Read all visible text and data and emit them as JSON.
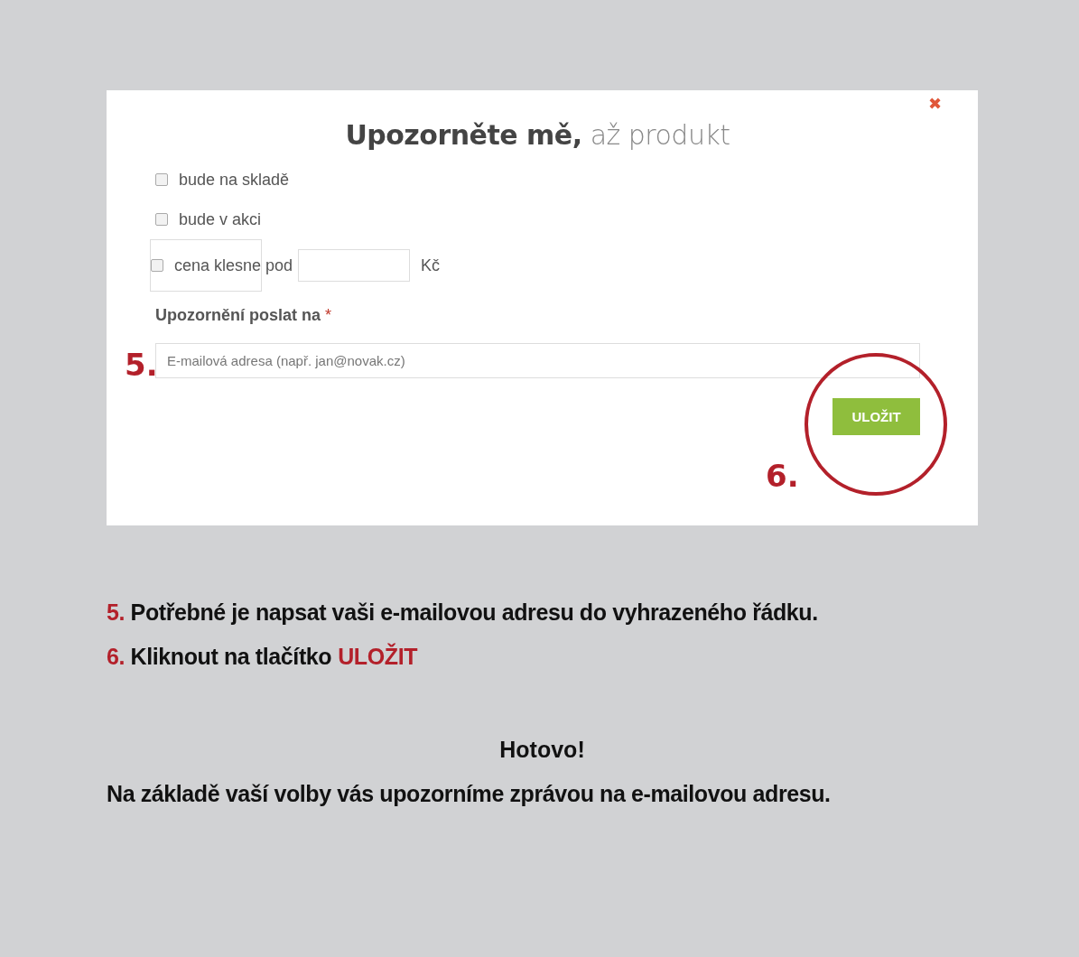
{
  "dialog": {
    "close_glyph": "✖",
    "title_bold": "Upozorněte mě,",
    "title_light": "až produkt",
    "options": [
      {
        "kind": "plain",
        "label": "bude na skladě",
        "checked": false
      },
      {
        "kind": "plain",
        "label": "bude v akci",
        "checked": false
      },
      {
        "kind": "price",
        "label": "cena klesne pod",
        "checked": false,
        "unit": "Kč"
      }
    ],
    "email_label": "Upozornění poslat na",
    "required_mark": "*",
    "email_placeholder": "E-mailová adresa (např. jan@novak.cz)",
    "save_button": "ULOŽIT",
    "markers": [
      "5.",
      "6."
    ]
  },
  "steps": [
    {
      "number": "5.",
      "text": "Potřebné je napsat vaši e-mailovou adresu do vyhrazeného řádku."
    },
    {
      "number": "6.",
      "text": "Kliknout na tlačítko",
      "highlight": "ULOŽIT"
    }
  ],
  "done_title": "Hotovo!",
  "done_text": "Na základě vaší volby vás upozorníme zprávou na e-mailovou adresu."
}
